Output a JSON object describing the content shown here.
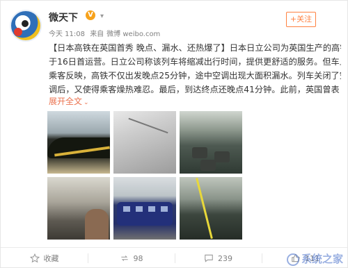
{
  "user": {
    "name": "微天下",
    "vip_badge": "V"
  },
  "post": {
    "time": "今天 11:08",
    "source_prefix": "来自",
    "source": "微博 weibo.com",
    "lines": [
      "【日本高铁在英国首秀 晚点、漏水、还热爆了】日本日立公司为英国生产的高铁",
      "于16日首运营。日立公司称该列车将缩减出行时间，提供更舒适的服务。但车上",
      "乘客反映，高铁不仅出发晚点25分钟，途中空调出现大面积漏水。列车关闭了空",
      "调后，又使得乘客燥热难忍。最后，到达终点还晚点41分钟。此前，英国曾表"
    ],
    "expand_label": "展开全文"
  },
  "follow_label": "+关注",
  "actions": {
    "favorite": {
      "label": "收藏",
      "icon": "star-icon"
    },
    "repost": {
      "count": "98",
      "icon": "repost-icon"
    },
    "comment": {
      "count": "239",
      "icon": "comment-icon"
    },
    "like": {
      "count": "111",
      "icon": "thumbs-up-icon"
    }
  },
  "watermark": "系统之家",
  "colors": {
    "accent": "#ff8140",
    "link": "#eb7350"
  }
}
